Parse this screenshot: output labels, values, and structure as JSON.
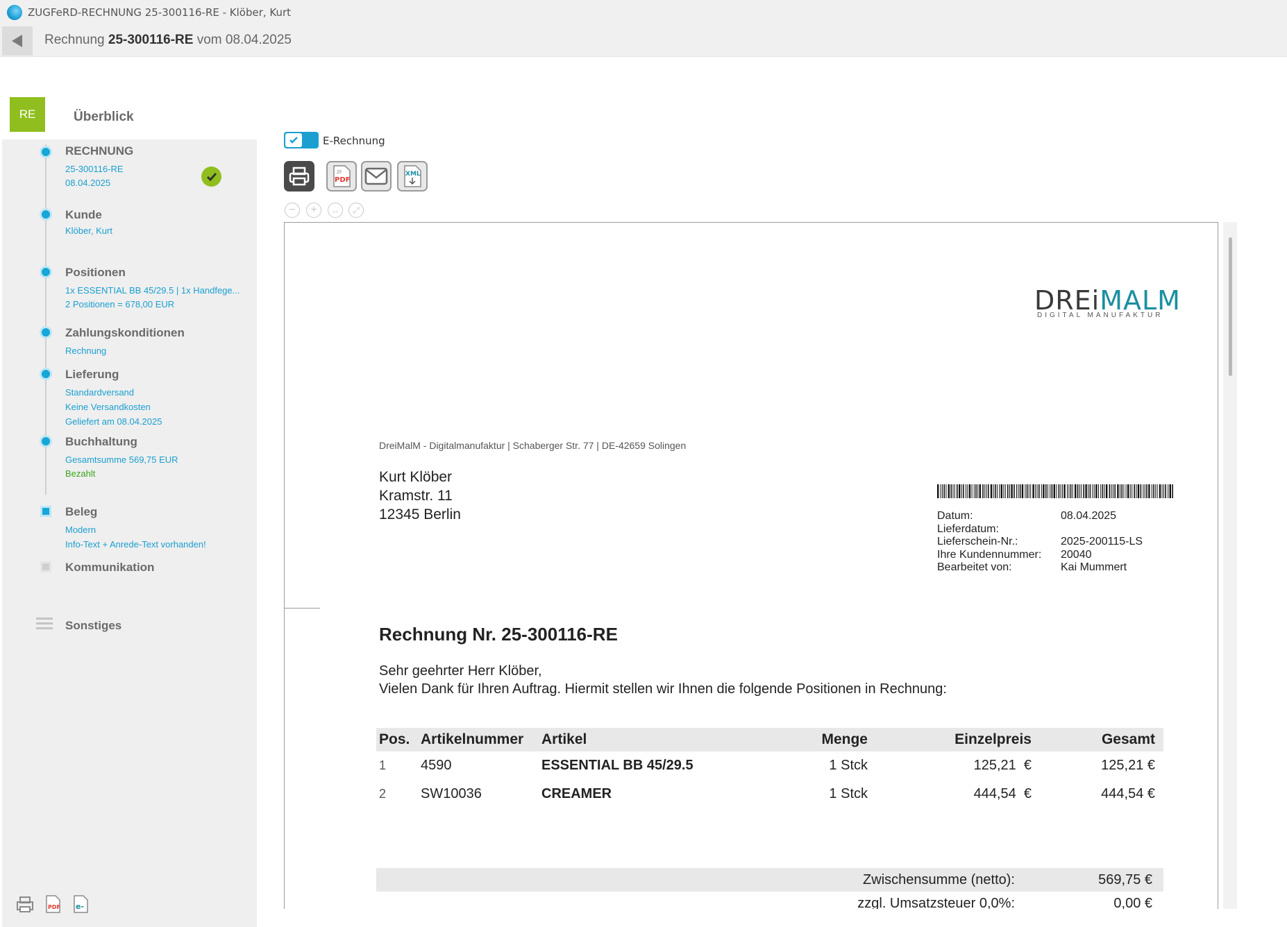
{
  "window": {
    "title": "ZUGFeRD-RECHNUNG 25-300116-RE - Klöber, Kurt"
  },
  "header": {
    "prefix": "Rechnung",
    "number": "25-300116-RE",
    "suffix": "vom 08.04.2025"
  },
  "sidebar": {
    "badge": "RE",
    "overview": "Überblick",
    "steps": [
      {
        "label": "RECHNUNG",
        "lines": [
          "25-300116-RE",
          "08.04.2025"
        ]
      },
      {
        "label": "Kunde",
        "lines": [
          "Klöber, Kurt"
        ]
      },
      {
        "label": "Positionen",
        "lines": [
          "1x ESSENTIAL BB 45/29.5 | 1x Handfege...",
          "2 Positionen = 678,00 EUR"
        ]
      },
      {
        "label": "Zahlungskonditionen",
        "lines": [
          "Rechnung"
        ]
      },
      {
        "label": "Lieferung",
        "lines": [
          "Standardversand",
          "Keine Versandkosten",
          "Geliefert am 08.04.2025"
        ]
      },
      {
        "label": "Buchhaltung",
        "lines": [
          "Gesamtsumme 569,75 EUR",
          "Bezahlt"
        ]
      },
      {
        "label": "Beleg",
        "lines": [
          "Modern",
          "Info-Text + Anrede-Text vorhanden!"
        ]
      },
      {
        "label": "Kommunikation",
        "lines": []
      },
      {
        "label": "Sonstiges",
        "lines": []
      }
    ]
  },
  "toolbar": {
    "toggle_label": "E-Rechnung",
    "toggle_on": true,
    "pdf_icon_text": "PDF",
    "xml_icon_text": "XML"
  },
  "document": {
    "logo_main_a": "DREi",
    "logo_main_b": "MALM",
    "logo_sub": "DIGITAL MANUFAKTUR",
    "sender_line": "DreiMalM - Digitalmanufaktur | Schaberger Str. 77 | DE-42659 Solingen",
    "recipient": [
      "Kurt Klöber",
      "Kramstr. 11",
      "12345 Berlin"
    ],
    "meta": [
      {
        "key": "Datum:",
        "value": "08.04.2025"
      },
      {
        "key": "Lieferdatum:",
        "value": ""
      },
      {
        "key": "Lieferschein-Nr.:",
        "value": "2025-200115-LS"
      },
      {
        "key": "Ihre Kundennummer:",
        "value": "20040"
      },
      {
        "key": "Bearbeitet von:",
        "value": "Kai Mummert"
      }
    ],
    "title": "Rechnung Nr.  25-300116-RE",
    "greeting": "Sehr geehrter Herr Klöber,",
    "intro": "Vielen Dank für Ihren Auftrag. Hiermit stellen wir Ihnen die folgende Positionen in Rechnung:",
    "table": {
      "headers": [
        "Pos.",
        "Artikelnummer",
        "Artikel",
        "Menge",
        "Einzelpreis",
        "Gesamt"
      ],
      "rows": [
        [
          "1",
          "4590",
          "ESSENTIAL BB 45/29.5",
          "1 Stck",
          "125,21  €",
          "125,21 €"
        ],
        [
          "2",
          "SW10036",
          "CREAMER",
          "1 Stck",
          "444,54  €",
          "444,54 €"
        ]
      ]
    },
    "totals": [
      {
        "label": "Zwischensumme (netto):",
        "value": "569,75 €"
      },
      {
        "label": "zzgl. Umsatzsteuer 0,0%:",
        "value": "0,00 €"
      }
    ]
  },
  "colors": {
    "accent": "#16a6d8",
    "badge": "#8fbe1e",
    "link": "#1a9fd0",
    "paid": "#3aa51f"
  }
}
